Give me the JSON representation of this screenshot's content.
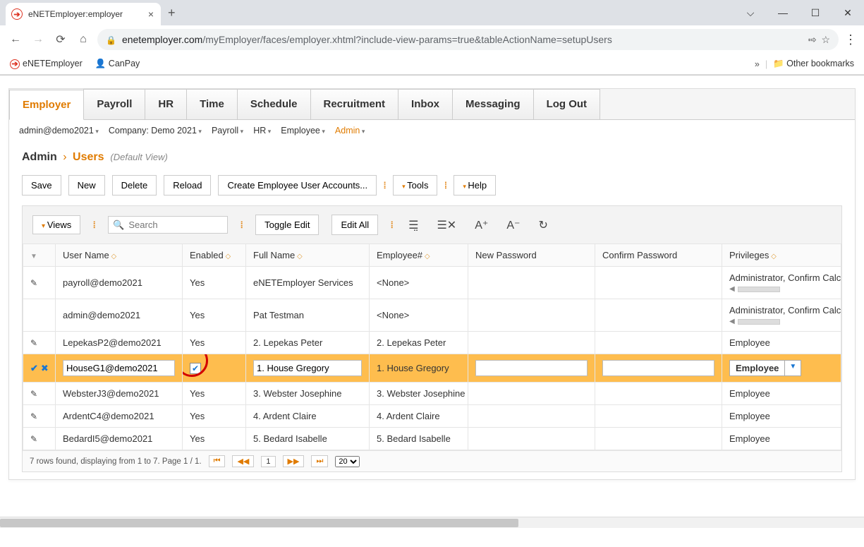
{
  "browser": {
    "tab_title": "eNETEmployer:employer",
    "url_host": "enetemployer.com",
    "url_path": "/myEmployer/faces/employer.xhtml?include-view-params=true&tableActionName=setupUsers",
    "bookmarks": {
      "b1": "eNETEmployer",
      "b2": "CanPay",
      "other": "Other bookmarks"
    }
  },
  "nav": {
    "tabs": [
      "Employer",
      "Payroll",
      "HR",
      "Time",
      "Schedule",
      "Recruitment",
      "Inbox",
      "Messaging",
      "Log Out"
    ],
    "active": "Employer"
  },
  "submenu": {
    "items": [
      "admin@demo2021",
      "Company: Demo 2021",
      "Payroll",
      "HR",
      "Employee",
      "Admin"
    ],
    "active": "Admin"
  },
  "title": {
    "section": "Admin",
    "page": "Users",
    "view": "(Default View)"
  },
  "actions": {
    "save": "Save",
    "new": "New",
    "delete": "Delete",
    "reload": "Reload",
    "create_accounts": "Create Employee User Accounts...",
    "tools": "Tools",
    "help": "Help"
  },
  "panel_toolbar": {
    "views": "Views",
    "search_placeholder": "Search",
    "toggle_edit": "Toggle Edit",
    "edit_all": "Edit All"
  },
  "table": {
    "headers": {
      "user": "User Name",
      "enabled": "Enabled",
      "fullname": "Full Name",
      "employee": "Employee#",
      "newpass": "New Password",
      "confpass": "Confirm Password",
      "priv": "Privileges"
    },
    "rows": [
      {
        "user": "payroll@demo2021",
        "enabled": "Yes",
        "fullname": "eNETEmployer Services",
        "employee": "<None>",
        "priv": "Administrator, Confirm Calculation, D",
        "priv_sub": true
      },
      {
        "user": "admin@demo2021",
        "enabled": "Yes",
        "fullname": "Pat Testman",
        "employee": "<None>",
        "priv": "Administrator, Confirm Calculation, D",
        "priv_sub": true,
        "noedit": true
      },
      {
        "user": "LepekasP2@demo2021",
        "enabled": "Yes",
        "fullname": "2. Lepekas Peter",
        "employee": "2. Lepekas Peter",
        "priv": "Employee"
      },
      {
        "user": "HouseG1@demo2021",
        "enabled": "checked",
        "fullname": "1. House Gregory",
        "employee": "1. House Gregory",
        "priv": "Employee",
        "selected": true
      },
      {
        "user": "WebsterJ3@demo2021",
        "enabled": "Yes",
        "fullname": "3. Webster Josephine",
        "employee": "3. Webster Josephine",
        "priv": "Employee"
      },
      {
        "user": "ArdentC4@demo2021",
        "enabled": "Yes",
        "fullname": "4. Ardent Claire",
        "employee": "4. Ardent Claire",
        "priv": "Employee"
      },
      {
        "user": "BedardI5@demo2021",
        "enabled": "Yes",
        "fullname": "5. Bedard Isabelle",
        "employee": "5. Bedard Isabelle",
        "priv": "Employee"
      }
    ],
    "footer": "7 rows found, displaying from 1 to 7. Page 1 / 1.",
    "page_current": "1",
    "page_size": "20",
    "priv_select": "Employee"
  }
}
